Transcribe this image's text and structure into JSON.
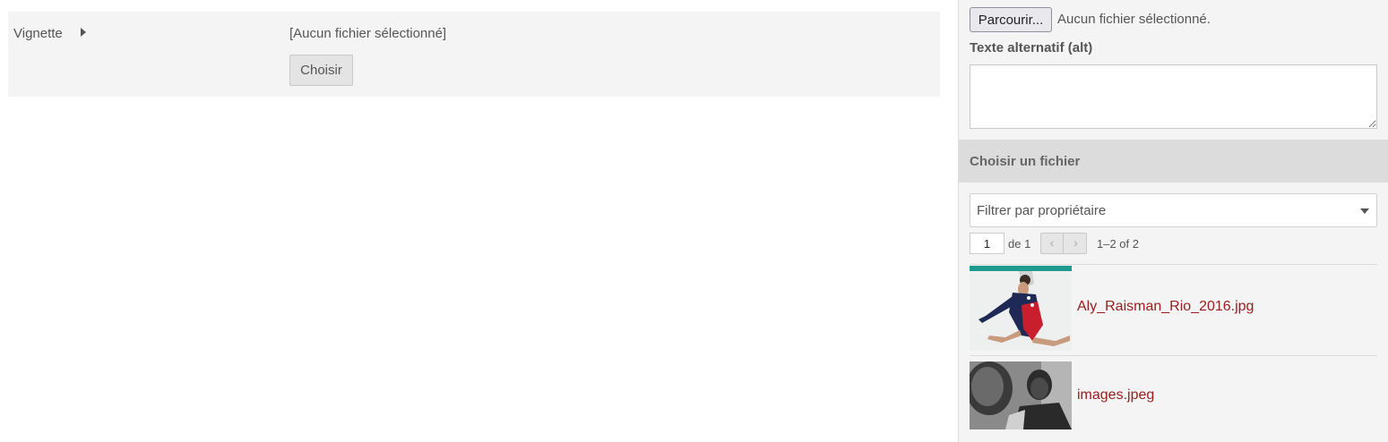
{
  "form": {
    "vignette_label": "Vignette",
    "file_status": "[Aucun fichier sélectionné]",
    "choose_button": "Choisir"
  },
  "sidebar": {
    "browse_button": "Parcourir...",
    "browse_status": "Aucun fichier sélectionné.",
    "alt_label": "Texte alternatif (alt)",
    "section_title": "Choisir un fichier",
    "owner_filter": "Filtrer par propriétaire",
    "page_value": "1",
    "page_of": "de 1",
    "range": "1–2 of 2",
    "files": [
      {
        "name": "Aly_Raisman_Rio_2016.jpg"
      },
      {
        "name": "images.jpeg"
      }
    ]
  },
  "colors": {
    "link": "#9b1c1c",
    "panel_bg": "#f4f4f4",
    "header_bg": "#dcdcdc"
  }
}
